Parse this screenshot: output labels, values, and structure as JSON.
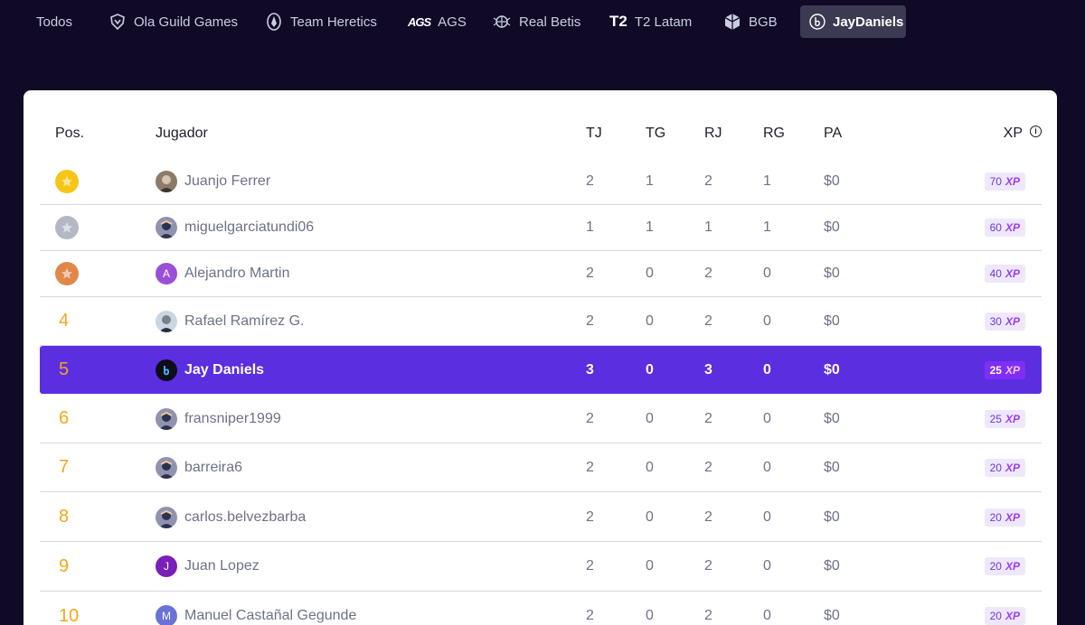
{
  "tabs": [
    {
      "label": "Todos",
      "icon": "none",
      "active": false
    },
    {
      "label": "Ola Guild Games",
      "icon": "ola-shield-icon",
      "active": false
    },
    {
      "label": "Team Heretics",
      "icon": "heretics-logo-icon",
      "active": false
    },
    {
      "label": "AGS",
      "icon": "ags-logo-icon",
      "logo_text": "AGS",
      "active": false
    },
    {
      "label": "Real Betis",
      "icon": "betis-crest-icon",
      "active": false
    },
    {
      "label": "T2 Latam",
      "icon": "t2-logo-icon",
      "logo_text": "T2",
      "active": false
    },
    {
      "label": "BGB",
      "icon": "bgb-cube-icon",
      "active": false
    },
    {
      "label": "JayDaniels",
      "icon": "jaydaniels-logo-icon",
      "active": true
    }
  ],
  "table": {
    "headers": {
      "pos": "Pos.",
      "player": "Jugador",
      "tj": "TJ",
      "tg": "TG",
      "rj": "RJ",
      "rg": "RG",
      "pa": "PA",
      "xp": "XP"
    },
    "xp_suffix": "XP",
    "rows": [
      {
        "pos": "1",
        "medal": "gold",
        "name": "Juanjo Ferrer",
        "avatar": "photo",
        "avatar_letter": "",
        "tj": "2",
        "tg": "1",
        "rj": "2",
        "rg": "1",
        "pa": "$0",
        "xp": "70",
        "highlight": false
      },
      {
        "pos": "2",
        "medal": "silver",
        "name": "miguelgarciatundi06",
        "avatar": "default",
        "avatar_letter": "",
        "tj": "1",
        "tg": "1",
        "rj": "1",
        "rg": "1",
        "pa": "$0",
        "xp": "60",
        "highlight": false
      },
      {
        "pos": "3",
        "medal": "bronze",
        "name": "Alejandro Martin",
        "avatar": "letter",
        "avatar_letter": "A",
        "tj": "2",
        "tg": "0",
        "rj": "2",
        "rg": "0",
        "pa": "$0",
        "xp": "40",
        "highlight": false
      },
      {
        "pos": "4",
        "medal": "",
        "name": "Rafael Ramírez G.",
        "avatar": "photo2",
        "avatar_letter": "",
        "tj": "2",
        "tg": "0",
        "rj": "2",
        "rg": "0",
        "pa": "$0",
        "xp": "30",
        "highlight": false
      },
      {
        "pos": "5",
        "medal": "",
        "name": "Jay Daniels",
        "avatar": "jd",
        "avatar_letter": "",
        "tj": "3",
        "tg": "0",
        "rj": "3",
        "rg": "0",
        "pa": "$0",
        "xp": "25",
        "highlight": true
      },
      {
        "pos": "6",
        "medal": "",
        "name": "fransniper1999",
        "avatar": "default",
        "avatar_letter": "",
        "tj": "2",
        "tg": "0",
        "rj": "2",
        "rg": "0",
        "pa": "$0",
        "xp": "25",
        "highlight": false
      },
      {
        "pos": "7",
        "medal": "",
        "name": "barreira6",
        "avatar": "default",
        "avatar_letter": "",
        "tj": "2",
        "tg": "0",
        "rj": "2",
        "rg": "0",
        "pa": "$0",
        "xp": "20",
        "highlight": false
      },
      {
        "pos": "8",
        "medal": "",
        "name": "carlos.belvezbarba",
        "avatar": "default",
        "avatar_letter": "",
        "tj": "2",
        "tg": "0",
        "rj": "2",
        "rg": "0",
        "pa": "$0",
        "xp": "20",
        "highlight": false
      },
      {
        "pos": "9",
        "medal": "",
        "name": "Juan Lopez",
        "avatar": "letter",
        "avatar_letter": "J",
        "tj": "2",
        "tg": "0",
        "rj": "2",
        "rg": "0",
        "pa": "$0",
        "xp": "20",
        "highlight": false
      },
      {
        "pos": "10",
        "medal": "",
        "name": "Manuel Castañal Gegunde",
        "avatar": "letter",
        "avatar_letter": "M",
        "tj": "2",
        "tg": "0",
        "rj": "2",
        "rg": "0",
        "pa": "$0",
        "xp": "20",
        "highlight": false
      }
    ]
  },
  "colors": {
    "background": "#110a27",
    "highlight_row": "#5b2ee0",
    "position_number": "#f0a818",
    "gold": "#f5c518",
    "silver": "#b4b8c4",
    "bronze": "#e0884a",
    "avatar_A": "#9b4fd6",
    "avatar_J": "#7a1fb8",
    "avatar_M": "#6a72d6"
  }
}
